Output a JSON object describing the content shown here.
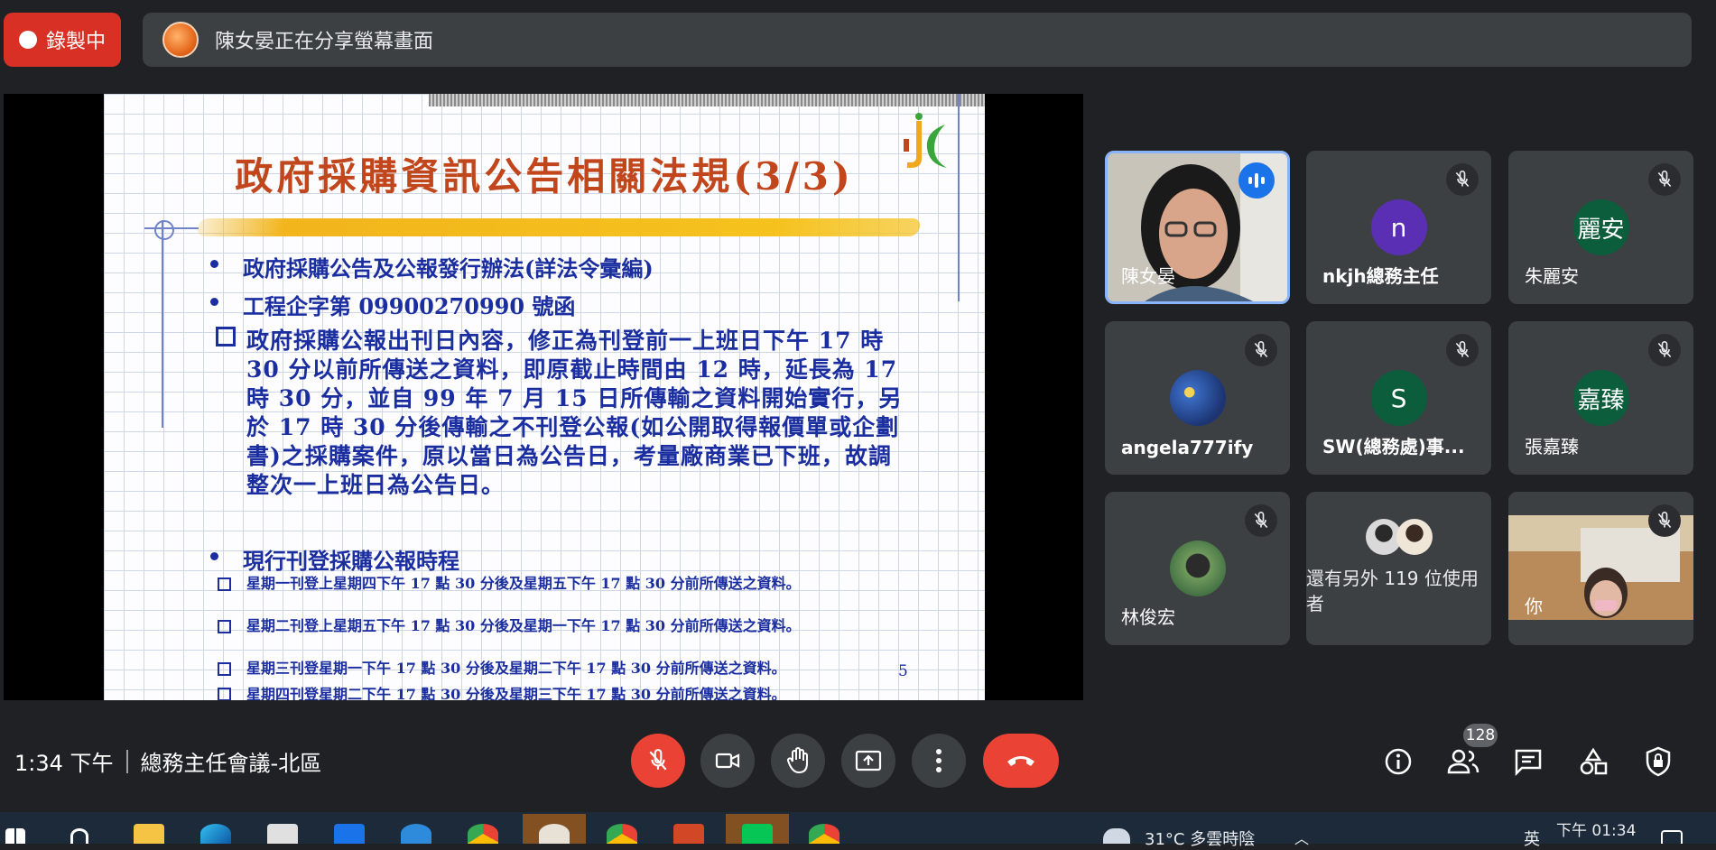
{
  "top": {
    "recording_label": "錄製中",
    "share_banner": "陳女晏正在分享螢幕畫面"
  },
  "slide": {
    "title": "政府採購資訊公告相關法規(3/3)",
    "bullets": [
      "政府採購公告及公報發行辦法(詳法令彙編)",
      "工程企字第 09900270990 號函"
    ],
    "paragraph": "政府採購公報出刊日內容，修正為刊登前一上班日下午 17 時 30 分以前所傳送之資料，即原截止時間由 12 時，延長為 17 時 30 分，並自 99 年 7 月 15 日所傳輸之資料開始實行，另於 17 時 30 分後傳輸之不刊登公報(如公開取得報價單或企劃書)之採購案件，原以當日為公告日，考量廠商業已下班，故調整次一上班日為公告日。",
    "schedule_heading": "現行刊登採購公報時程",
    "schedule_items": [
      "星期一刊登上星期四下午 17 點 30 分後及星期五下午 17 點 30 分前所傳送之資料。",
      "星期二刊登上星期五下午 17 點 30 分後及星期一下午 17 點 30 分前所傳送之資料。",
      "星期三刊登星期一下午 17 點 30 分後及星期二下午 17 點 30 分前所傳送之資料。",
      "星期四刊登星期二下午 17 點 30 分後及星期三下午 17 點 30 分前所傳送之資料。"
    ],
    "page_number": "5"
  },
  "participants": [
    {
      "name": "陳女晏",
      "type": "video",
      "speaking": true
    },
    {
      "name": "nkjh總務主任",
      "avatar": "n",
      "color": "#5b2fb4"
    },
    {
      "name": "朱麗安",
      "avatar": "麗安",
      "color": "#0b5d3b"
    },
    {
      "name": "angela777ify",
      "avatar": "",
      "color": "#1e3f8a"
    },
    {
      "name": "SW(總務處)事...",
      "avatar": "S",
      "color": "#0b5d3b"
    },
    {
      "name": "張嘉臻",
      "avatar": "嘉臻",
      "color": "#0b5d3b"
    },
    {
      "name": "林俊宏",
      "avatar": "",
      "color": "#4a7a4a"
    },
    {
      "name": "還有另外 119 位使用者",
      "type": "others"
    },
    {
      "name": "你",
      "type": "video"
    }
  ],
  "bottom": {
    "time": "1:34 下午",
    "meeting_title": "總務主任會議-北區",
    "people_count": "128"
  },
  "taskbar": {
    "weather": "31°C 多雲時陰",
    "ime": "英",
    "clock": "下午 01:34"
  },
  "colors": {
    "record_red": "#d93025",
    "end_call_red": "#ea4335",
    "speaking_blue": "#1a73e8",
    "tile_bg": "#3c4043"
  }
}
